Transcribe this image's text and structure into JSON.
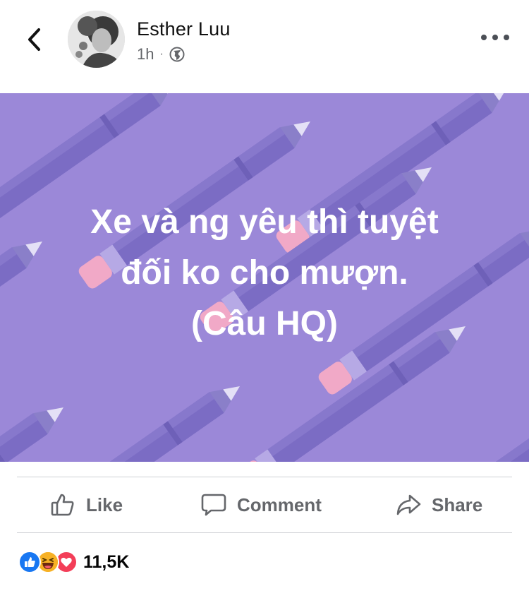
{
  "header": {
    "author": "Esther Luu",
    "time": "1h",
    "separator": "·",
    "icons": {
      "back": "chevron-left-icon",
      "privacy": "globe-icon",
      "more": "more-dots-icon"
    }
  },
  "post": {
    "text": "Xe và ng yêu thì tuyệt\nđối ko cho mượn.\n(Câu HQ)",
    "background_color": "#9b88d8",
    "pattern": "pencils"
  },
  "actions": {
    "like": "Like",
    "comment": "Comment",
    "share": "Share"
  },
  "reactions": {
    "types": [
      "like",
      "haha",
      "love"
    ],
    "count": "11,5K"
  }
}
